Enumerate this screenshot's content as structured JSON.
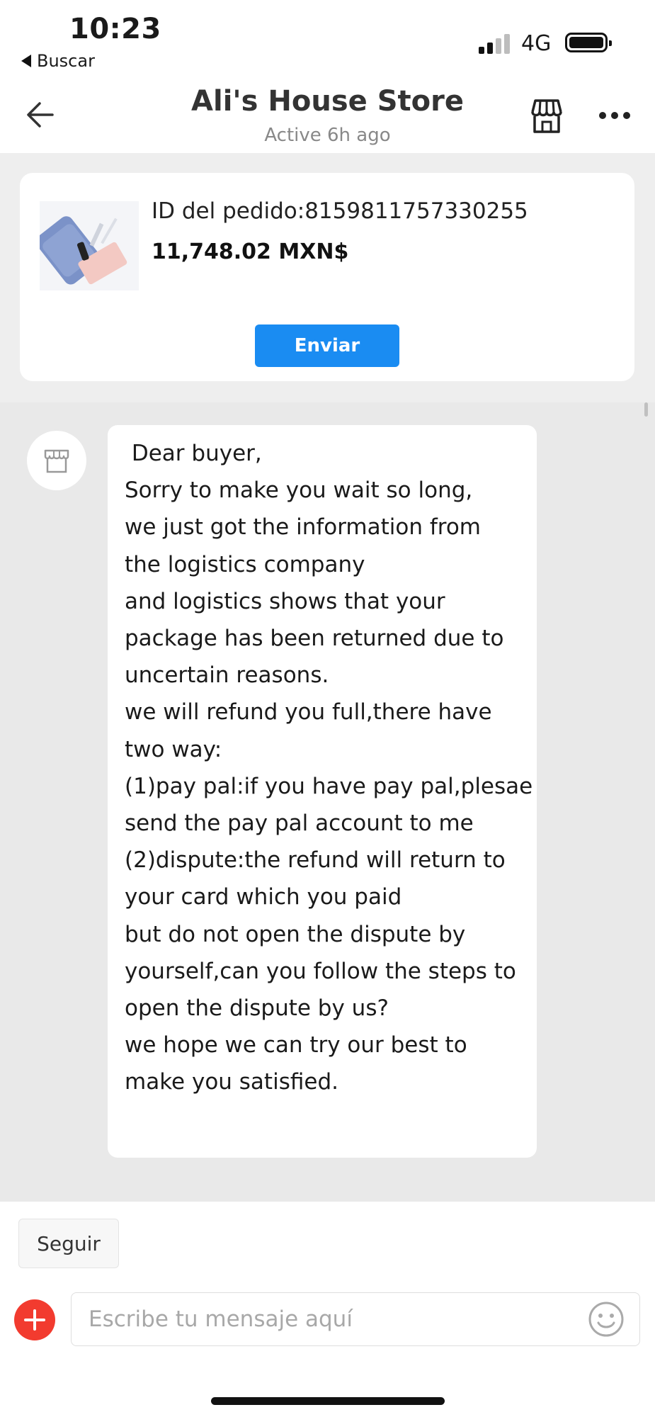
{
  "status_bar": {
    "time": "10:23",
    "back_app_label": "Buscar",
    "network": "4G"
  },
  "header": {
    "title": "Ali's House Store",
    "status": "Active 6h ago"
  },
  "order": {
    "id_text": "ID del pedido:8159811757330255",
    "price": "11,748.02 MXN$",
    "send_label": "Enviar"
  },
  "chat": {
    "messages": [
      {
        "sender": "store",
        "text": " Dear buyer,\nSorry to make you wait so long,\nwe just got the information from\nthe logistics company\nand logistics shows that your\npackage has been returned due to\nuncertain reasons.\nwe will refund you full,there have\ntwo way:\n(1)pay pal:if you have pay pal,plesae\nsend the pay pal account to me\n(2)dispute:the refund will return to\nyour card which you paid\nbut do not open the dispute by\nyourself,can you follow the steps to\nopen the dispute by us?\nwe hope we can try our best to\nmake you satisfied."
      }
    ]
  },
  "bottom": {
    "follow_label": "Seguir",
    "input_placeholder": "Escribe tu mensaje aquí",
    "input_value": ""
  },
  "colors": {
    "accent_blue": "#1a8cf2",
    "plus_red": "#f23b2f",
    "chat_background": "#e9e9e9"
  },
  "icons": [
    "back-arrow-icon",
    "store-icon",
    "more-icon",
    "store-avatar-icon",
    "plus-icon",
    "emoji-icon"
  ]
}
